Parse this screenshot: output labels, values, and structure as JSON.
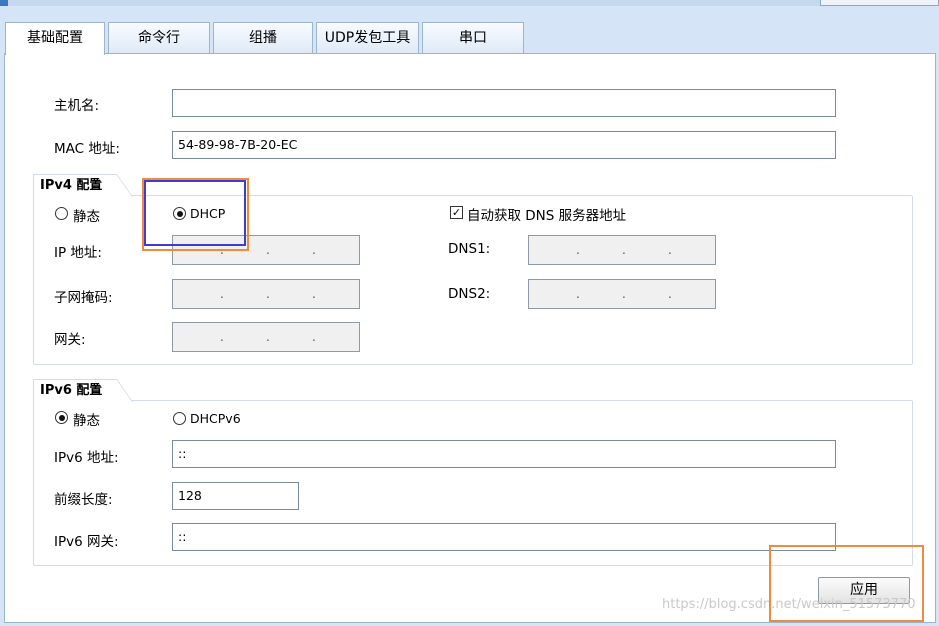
{
  "tabs": [
    {
      "label": "基础配置",
      "active": true
    },
    {
      "label": "命令行",
      "active": false
    },
    {
      "label": "组播",
      "active": false
    },
    {
      "label": "UDP发包工具",
      "active": false
    },
    {
      "label": "串口",
      "active": false
    }
  ],
  "basic": {
    "hostname_label": "主机名:",
    "hostname_value": "",
    "mac_label": "MAC 地址:",
    "mac_value": "54-89-98-7B-20-EC"
  },
  "ipv4": {
    "title": "IPv4 配置",
    "static_label": "静态",
    "static_checked": false,
    "dhcp_label": "DHCP",
    "dhcp_checked": true,
    "auto_dns_label": "自动获取 DNS 服务器地址",
    "auto_dns_checked": true,
    "ip_label": "IP 地址:",
    "mask_label": "子网掩码:",
    "gateway_label": "网关:",
    "dns1_label": "DNS1:",
    "dns2_label": "DNS2:",
    "ip_dot": "."
  },
  "ipv6": {
    "title": "IPv6 配置",
    "static_label": "静态",
    "static_checked": true,
    "dhcpv6_label": "DHCPv6",
    "dhcpv6_checked": false,
    "address_label": "IPv6 地址:",
    "address_value": "::",
    "prefix_label": "前缀长度:",
    "prefix_value": "128",
    "gateway_label": "IPv6 网关:",
    "gateway_value": "::"
  },
  "apply_label": "应用",
  "watermark": "https://blog.csdn.net/weixin_51573770",
  "colors": {
    "highlight_orange": "#f08a3c",
    "highlight_blue": "#3d3dd6",
    "window_bg": "#d5e5f7"
  }
}
